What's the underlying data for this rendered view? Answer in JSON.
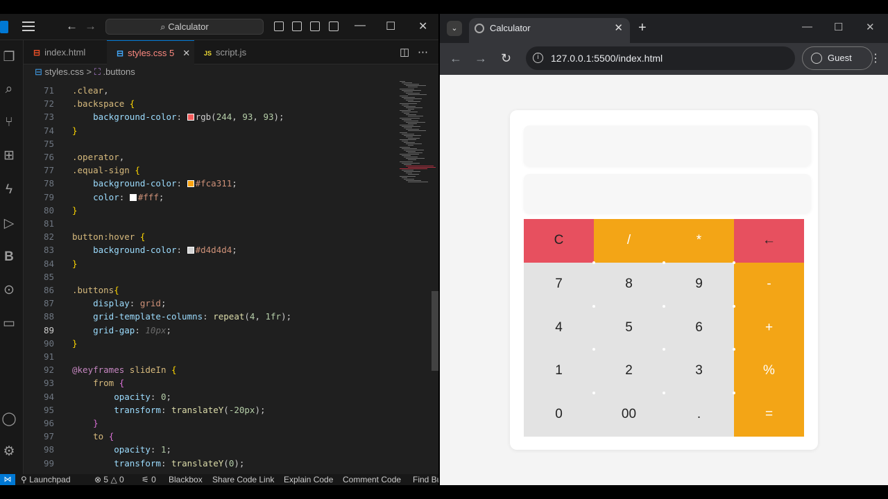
{
  "vscode": {
    "search_label": "Calculator",
    "tabs": [
      {
        "icon": "html-file-icon",
        "label": "index.html"
      },
      {
        "icon": "css-file-icon",
        "label": "styles.css",
        "badge": "5"
      },
      {
        "icon": "js-file-icon",
        "label": "script.js"
      }
    ],
    "breadcrumb": {
      "file": "styles.css",
      "sep": ">",
      "symbol": ".buttons"
    },
    "code_lines": [
      {
        "n": "71",
        "html": "<span class='sel'>.clear</span>,"
      },
      {
        "n": "72",
        "html": "<span class='sel'>.backspace</span> <span class='brk'>{</span>"
      },
      {
        "n": "73",
        "html": "    <span class='prop'>background-color</span>: <span class='sw' style='background:#f45d5d'></span>rgb(<span class='num'>244</span>, <span class='num'>93</span>, <span class='num'>93</span>);"
      },
      {
        "n": "74",
        "html": "<span class='brk'>}</span>"
      },
      {
        "n": "75",
        "html": ""
      },
      {
        "n": "76",
        "html": "<span class='sel'>.operator</span>,"
      },
      {
        "n": "77",
        "html": "<span class='sel'>.equal-sign</span> <span class='brk'>{</span>"
      },
      {
        "n": "78",
        "html": "    <span class='prop'>background-color</span>: <span class='sw' style='background:#fca311'></span><span class='str'>#fca311</span>;"
      },
      {
        "n": "79",
        "html": "    <span class='prop'>color</span>: <span class='sw' style='background:#fff'></span><span class='str'>#fff</span>;"
      },
      {
        "n": "80",
        "html": "<span class='brk'>}</span>"
      },
      {
        "n": "81",
        "html": ""
      },
      {
        "n": "82",
        "html": "<span class='sel'>button:hover</span> <span class='brk'>{</span>"
      },
      {
        "n": "83",
        "html": "    <span class='prop'>background-color</span>: <span class='sw' style='background:#d4d4d4'></span><span class='str'>#d4d4d4</span>;"
      },
      {
        "n": "84",
        "html": "<span class='brk'>}</span>"
      },
      {
        "n": "85",
        "html": ""
      },
      {
        "n": "86",
        "html": "<span class='sel'>.buttons</span><span class='brk'>{</span>"
      },
      {
        "n": "87",
        "html": "    <span class='prop'>display</span>: <span class='str'>grid</span>;"
      },
      {
        "n": "88",
        "html": "    <span class='prop'>grid-template-columns</span>: <span class='fn'>repeat</span>(<span class='num'>4</span>, <span class='num'>1fr</span>);"
      },
      {
        "n": "89",
        "html": "    <span class='prop'>grid-gap</span>: <span class='ghost'>10px</span>;"
      },
      {
        "n": "90",
        "html": "<span class='brk'>}</span>"
      },
      {
        "n": "91",
        "html": ""
      },
      {
        "n": "92",
        "html": "<span class='kw'>@keyframes</span> <span class='sel'>slideIn</span> <span class='brk'>{</span>"
      },
      {
        "n": "93",
        "html": "    <span class='sel'>from</span> <span class='brk2'>{</span>"
      },
      {
        "n": "94",
        "html": "        <span class='prop'>opacity</span>: <span class='num'>0</span>;"
      },
      {
        "n": "95",
        "html": "        <span class='prop'>transform</span>: <span class='fn'>translateY</span>(<span class='num'>-20px</span>);"
      },
      {
        "n": "96",
        "html": "    <span class='brk2'>}</span>"
      },
      {
        "n": "97",
        "html": "    <span class='sel'>to</span> <span class='brk2'>{</span>"
      },
      {
        "n": "98",
        "html": "        <span class='prop'>opacity</span>: <span class='num'>1</span>;"
      },
      {
        "n": "99",
        "html": "        <span class='prop'>transform</span>: <span class='fn'>translateY</span>(<span class='num'>0</span>);"
      }
    ],
    "current_line": "89",
    "status": {
      "launchpad": "Launchpad",
      "errors": "5",
      "warnings": "0",
      "ports": "0",
      "items": [
        "Blackbox",
        "Share Code Link",
        "Explain Code",
        "Comment Code",
        "Find Bu"
      ]
    }
  },
  "browser": {
    "tab_title": "Calculator",
    "url": "127.0.0.1:5500/index.html",
    "profile": "Guest"
  },
  "calculator": {
    "rows": [
      [
        {
          "label": "C",
          "style": "red"
        },
        {
          "label": "/",
          "style": "orange"
        },
        {
          "label": "*",
          "style": "orange"
        },
        {
          "label": "←",
          "style": "red"
        }
      ],
      [
        {
          "label": "7",
          "style": "gray"
        },
        {
          "label": "8",
          "style": "gray"
        },
        {
          "label": "9",
          "style": "gray"
        },
        {
          "label": "-",
          "style": "orange"
        }
      ],
      [
        {
          "label": "4",
          "style": "gray"
        },
        {
          "label": "5",
          "style": "gray"
        },
        {
          "label": "6",
          "style": "gray"
        },
        {
          "label": "+",
          "style": "orange"
        }
      ],
      [
        {
          "label": "1",
          "style": "gray"
        },
        {
          "label": "2",
          "style": "gray"
        },
        {
          "label": "3",
          "style": "gray"
        },
        {
          "label": "%",
          "style": "orange"
        }
      ],
      [
        {
          "label": "0",
          "style": "gray"
        },
        {
          "label": "00",
          "style": "gray"
        },
        {
          "label": ".",
          "style": "gray"
        },
        {
          "label": "=",
          "style": "orange"
        }
      ]
    ],
    "colors": {
      "orange": "#f3a516",
      "red": "#e7505f",
      "gray": "#e3e3e3"
    }
  }
}
